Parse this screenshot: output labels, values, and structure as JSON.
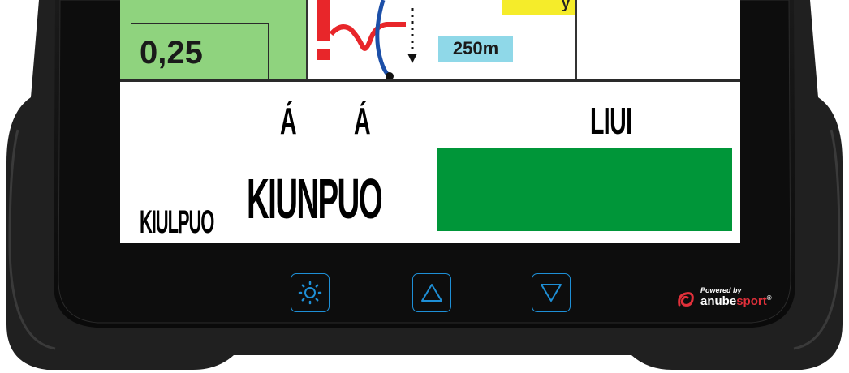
{
  "top_panel": {
    "value": "0,25",
    "distance": "250m",
    "yellow_tag_text": "y"
  },
  "labels": {
    "a1": "Á",
    "a2": "Á",
    "liui": "LIUI",
    "big": "KIUNPUO",
    "small": "KIULPUO"
  },
  "buttons": {
    "brightness": "brightness-icon",
    "up": "triangle-up-icon",
    "down": "triangle-down-icon"
  },
  "brand": {
    "powered": "Powered by",
    "name_part1": "anube",
    "name_part2": "sport",
    "reg": "®"
  },
  "colors": {
    "status_bar": "#009639",
    "accent_blue": "#1e8fd6",
    "brand_red": "#e0303a",
    "cell_green": "#8fd37e",
    "distance_tag": "#8fd8e8"
  }
}
